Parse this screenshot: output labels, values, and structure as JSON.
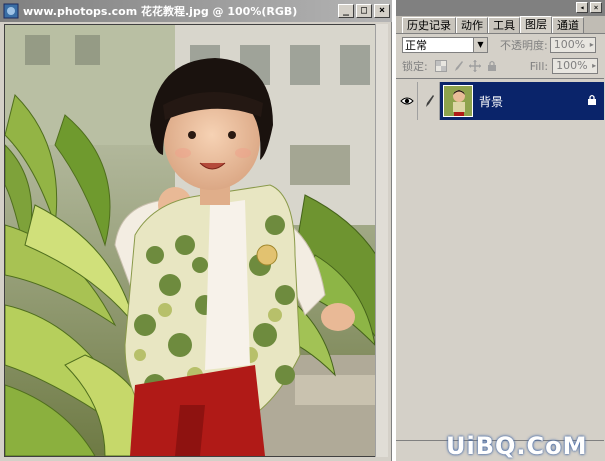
{
  "document": {
    "title": "www.photops.com 花花教程.jpg @ 100%(RGB)",
    "buttons": {
      "minimize": "_",
      "maximize": "□",
      "close": "×"
    }
  },
  "layers_panel": {
    "top_buttons": [
      "◂",
      "×"
    ],
    "tabs": [
      {
        "label": "历史记录",
        "active": false
      },
      {
        "label": "动作",
        "active": false
      },
      {
        "label": "工具",
        "active": false
      },
      {
        "label": "图层",
        "active": true
      },
      {
        "label": "通道",
        "active": false
      }
    ],
    "blend_mode": "正常",
    "opacity_label": "不透明度:",
    "opacity_value": "100%",
    "lock_label": "锁定:",
    "fill_label": "Fill:",
    "fill_value": "100%",
    "layers": [
      {
        "name": "背景",
        "visible": true,
        "locked": true,
        "selected": true
      }
    ]
  },
  "watermark": "UiBQ.CoM",
  "colors": {
    "selection": "#0a246a",
    "chrome": "#d4d0c8",
    "titlebar": "#808080"
  }
}
